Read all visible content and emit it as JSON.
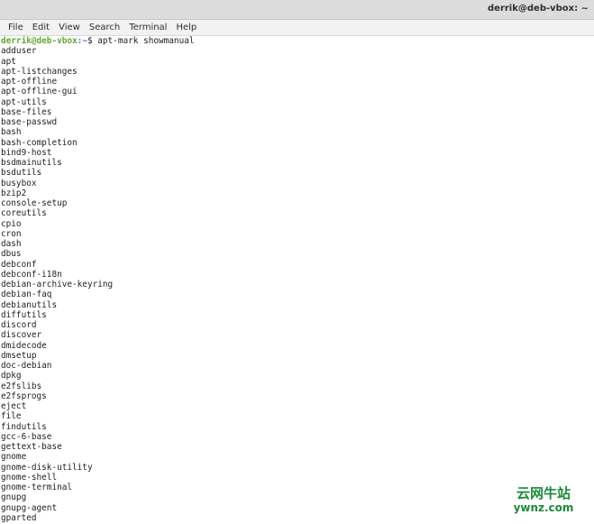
{
  "window": {
    "title": "derrik@deb-vbox: ~"
  },
  "menu": {
    "items": [
      "File",
      "Edit",
      "View",
      "Search",
      "Terminal",
      "Help"
    ]
  },
  "terminal": {
    "prompt_user_host": "derrik@deb-vbox",
    "prompt_path": ":~",
    "prompt_symbol": "$ ",
    "command": "apt-mark showmanual",
    "output": [
      "adduser",
      "apt",
      "apt-listchanges",
      "apt-offline",
      "apt-offline-gui",
      "apt-utils",
      "base-files",
      "base-passwd",
      "bash",
      "bash-completion",
      "bind9-host",
      "bsdmainutils",
      "bsdutils",
      "busybox",
      "bzip2",
      "console-setup",
      "coreutils",
      "cpio",
      "cron",
      "dash",
      "dbus",
      "debconf",
      "debconf-i18n",
      "debian-archive-keyring",
      "debian-faq",
      "debianutils",
      "diffutils",
      "discord",
      "discover",
      "dmidecode",
      "dmsetup",
      "doc-debian",
      "dpkg",
      "e2fslibs",
      "e2fsprogs",
      "eject",
      "file",
      "findutils",
      "gcc-6-base",
      "gettext-base",
      "gnome",
      "gnome-disk-utility",
      "gnome-shell",
      "gnome-terminal",
      "gnupg",
      "gnupg-agent",
      "gparted"
    ]
  },
  "watermark": {
    "cn": "云网牛站",
    "url": "ywnz.com"
  }
}
